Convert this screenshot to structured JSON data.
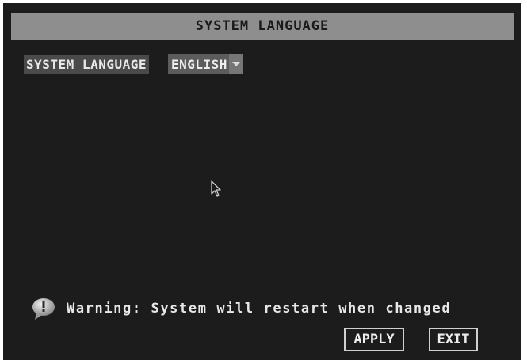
{
  "window": {
    "title": "SYSTEM LANGUAGE"
  },
  "settings": {
    "language_label": "SYSTEM LANGUAGE",
    "language_value": "ENGLISH"
  },
  "warning": {
    "text": "Warning: System will restart when changed",
    "icon": "warning-bubble-icon"
  },
  "buttons": {
    "apply": "APPLY",
    "exit": "EXIT"
  },
  "colors": {
    "background": "#1c1c1c",
    "title_bar": "#8e8e8e",
    "label_bg": "#4a4a4a",
    "select_bg": "#5c5c5c",
    "text": "#e6e6e6"
  }
}
